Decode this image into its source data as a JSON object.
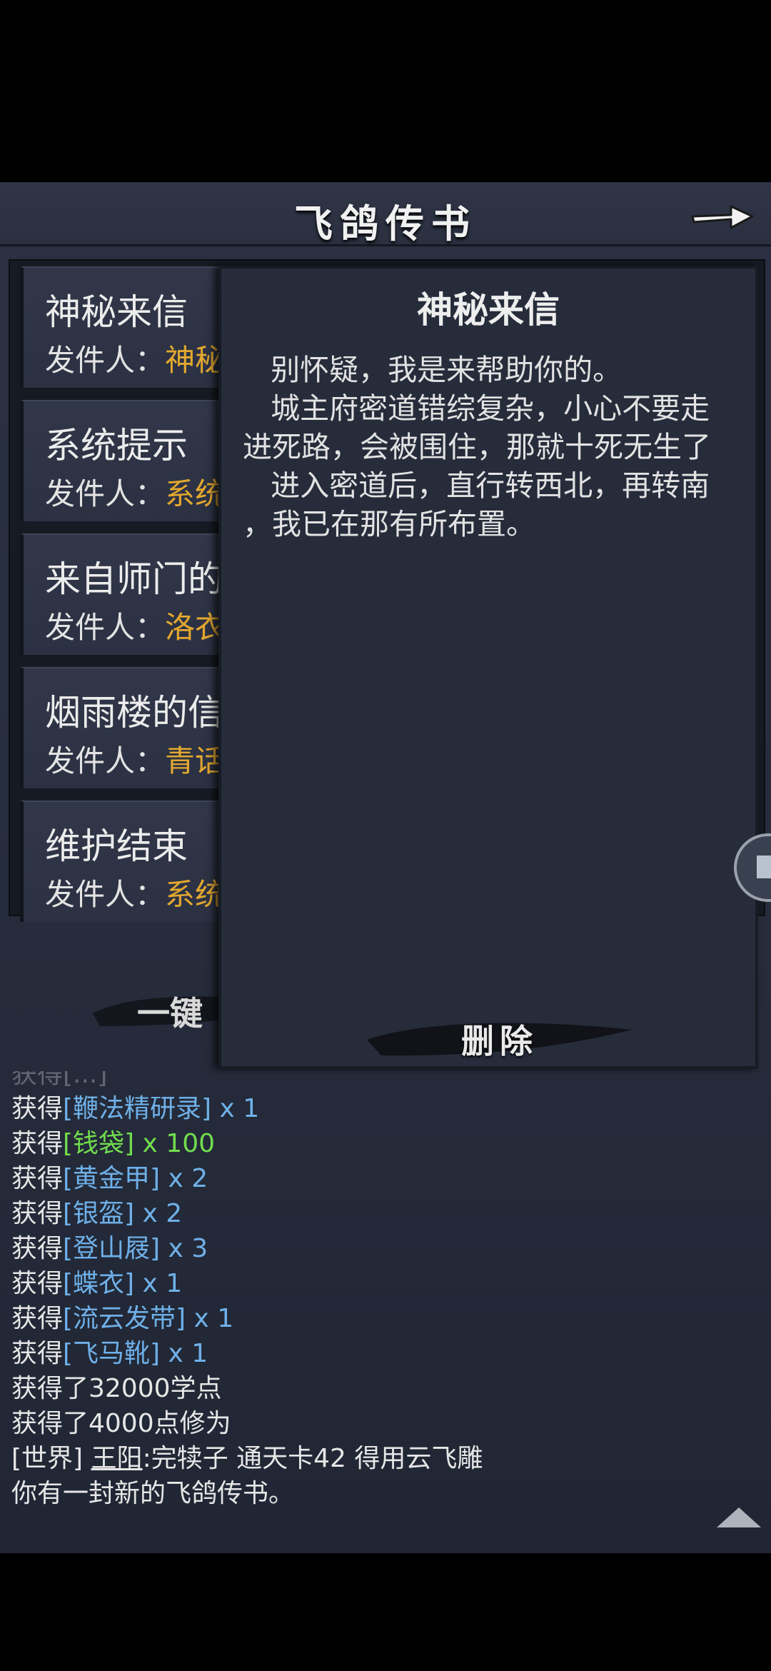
{
  "header": {
    "title": "飞鸽传书"
  },
  "mails": [
    {
      "subject": "神秘来信",
      "sender_label": "发件人：",
      "sender_name": "神秘"
    },
    {
      "subject": "系统提示",
      "sender_label": "发件人：",
      "sender_name": "系统"
    },
    {
      "subject": "来自师门的",
      "sender_label": "发件人：",
      "sender_name": "洛衣"
    },
    {
      "subject": "烟雨楼的信",
      "sender_label": "发件人：",
      "sender_name": "青话"
    },
    {
      "subject": "维护结束",
      "sender_label": "发件人：",
      "sender_name": "系统"
    }
  ],
  "read_all_label": "一键",
  "letter": {
    "title": "神秘来信",
    "lines": [
      "   别怀疑，我是来帮助你的。",
      "   城主府密道错综复杂，小心不要走",
      "进死路，会被围住，那就十死无生了",
      "   进入密道后，直行转西北，再转南",
      "，我已在那有所布置。"
    ],
    "delete_label": "删除"
  },
  "chat": {
    "cut_line": "获得[...]",
    "items": [
      {
        "prefix": "获得",
        "item": "[鞭法精研录]",
        "qty": " x 1",
        "color": "blue"
      },
      {
        "prefix": "获得",
        "item": "[钱袋]",
        "qty": " x 100",
        "color": "green"
      },
      {
        "prefix": "获得",
        "item": "[黄金甲]",
        "qty": " x 2",
        "color": "blue"
      },
      {
        "prefix": "获得",
        "item": "[银盔]",
        "qty": " x 2",
        "color": "blue"
      },
      {
        "prefix": "获得",
        "item": "[登山屐]",
        "qty": " x 3",
        "color": "blue"
      },
      {
        "prefix": "获得",
        "item": "[蝶衣]",
        "qty": " x 1",
        "color": "blue"
      },
      {
        "prefix": "获得",
        "item": "[流云发带]",
        "qty": " x 1",
        "color": "blue"
      },
      {
        "prefix": "获得",
        "item": "[飞马靴]",
        "qty": " x 1",
        "color": "blue"
      }
    ],
    "xp_line": "获得了32000学点",
    "cultivation_line": "获得了4000点修为",
    "world_tag": "[世界]",
    "world_user": "王阳",
    "world_message": ":完犊子 通天卡42 得用云飞雕",
    "new_mail_line": "你有一封新的飞鸽传书。"
  },
  "colors": {
    "sender_name": "#e3a82f",
    "item_blue": "#6fb0e8",
    "item_green": "#72dd4e"
  }
}
